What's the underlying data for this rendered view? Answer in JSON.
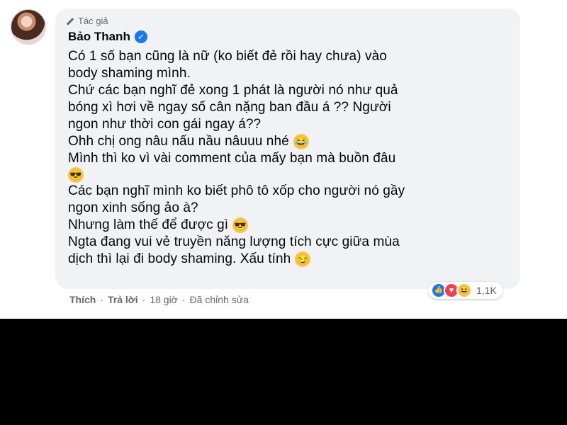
{
  "comment": {
    "author_badge": "Tác giả",
    "author_name": "Bảo Thanh",
    "lines": [
      {
        "text": "Có 1 số bạn cũng là nữ (ko biết đẻ rồi hay chưa) vào",
        "emoji": ""
      },
      {
        "text": "body shaming mình.",
        "emoji": ""
      },
      {
        "text": "Chứ các bạn nghĩ đẻ xong 1 phát là người nó như quả",
        "emoji": ""
      },
      {
        "text": "bóng xì hơi về ngay số cân nặng ban đầu á ?? Người",
        "emoji": ""
      },
      {
        "text": "ngon như thời con gái ngay á??",
        "emoji": ""
      },
      {
        "text": "Ohh chị ong nâu nấu nầu nâuuu nhé",
        "emoji": "laugh"
      },
      {
        "text": "Mình thì ko vì vài comment của mấy bạn mà buồn đâu",
        "emoji": ""
      },
      {
        "text": "",
        "emoji": "sunglasses"
      },
      {
        "text": "Các bạn nghĩ mình ko biết phô tô xốp cho người nó gầy",
        "emoji": ""
      },
      {
        "text": "ngon xinh sống ảo à?",
        "emoji": ""
      },
      {
        "text": "Nhưng làm thế để được gì",
        "emoji": "sunglasses"
      },
      {
        "text": "Ngta đang vui vẻ truyền năng lượng tích cực giữa mùa",
        "emoji": ""
      },
      {
        "text": "dịch thì lại đi body shaming. Xấu tính",
        "emoji": "smirk"
      }
    ]
  },
  "actions": {
    "like": "Thích",
    "reply": "Trả lời",
    "time": "18 giờ",
    "edited": "Đã chỉnh sửa",
    "dot": "·"
  },
  "reactions": {
    "count": "1,1K",
    "icons": [
      "like-icon",
      "love-icon",
      "haha-icon"
    ]
  },
  "colors": {
    "bubble": "#f0f2f5",
    "verified": "#1877f2",
    "muted_text": "#65676b"
  }
}
